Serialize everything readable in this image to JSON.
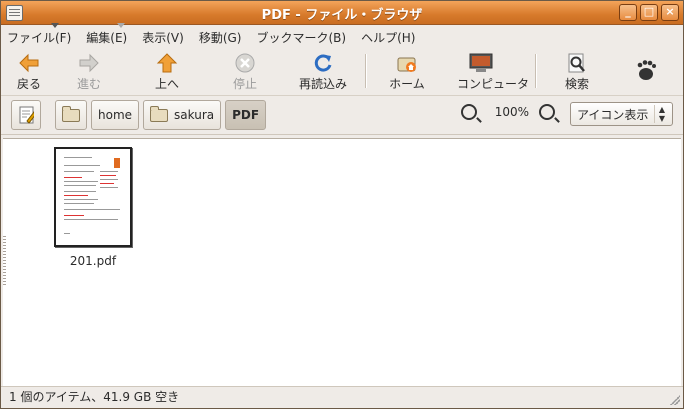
{
  "window": {
    "title": "PDF - ファイル・ブラウザ"
  },
  "menu": {
    "items": [
      "ファイル(F)",
      "編集(E)",
      "表示(V)",
      "移動(G)",
      "ブックマーク(B)",
      "ヘルプ(H)"
    ]
  },
  "toolbar": {
    "back": "戻る",
    "forward": "進む",
    "up": "上へ",
    "stop": "停止",
    "reload": "再読込み",
    "home": "ホーム",
    "computer": "コンピュータ",
    "search": "検索"
  },
  "path": {
    "crumbs": [
      "home",
      "sakura",
      "PDF"
    ]
  },
  "zoom": {
    "level": "100%"
  },
  "view": {
    "selected": "アイコン表示"
  },
  "files": [
    {
      "name": "201.pdf"
    }
  ],
  "status": {
    "text": "1 個のアイテム、41.9 GB 空き"
  }
}
